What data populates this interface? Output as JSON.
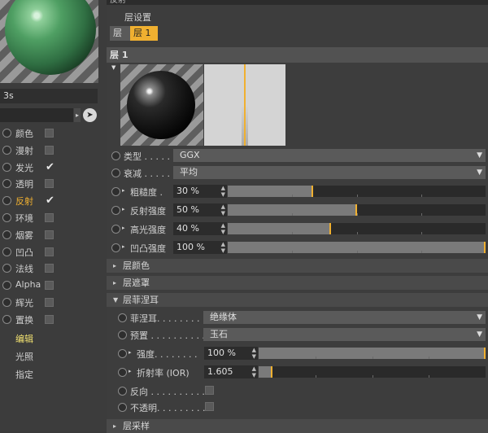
{
  "left": {
    "preset_name": "3s",
    "channels": [
      {
        "label": "颜色",
        "checked": false,
        "active": false
      },
      {
        "label": "漫射",
        "checked": false,
        "active": false
      },
      {
        "label": "发光",
        "checked": true,
        "active": false
      },
      {
        "label": "透明",
        "checked": false,
        "active": false
      },
      {
        "label": "反射",
        "checked": true,
        "active": true
      },
      {
        "label": "环境",
        "checked": false,
        "active": false
      },
      {
        "label": "烟雾",
        "checked": false,
        "active": false
      },
      {
        "label": "凹凸",
        "checked": false,
        "active": false
      },
      {
        "label": "法线",
        "checked": false,
        "active": false
      },
      {
        "label": "Alpha",
        "checked": false,
        "active": false
      },
      {
        "label": "辉光",
        "checked": false,
        "active": false
      },
      {
        "label": "置换",
        "checked": false,
        "active": false
      }
    ],
    "sub_items": [
      "编辑",
      "光照",
      "指定"
    ]
  },
  "right": {
    "top_title": "反射",
    "layer_settings_label": "层设置",
    "tab_layer": "层",
    "tab_layer1": "层 1",
    "section_layer1": "层 1",
    "type_label": "类型 . . . . . .",
    "type_value": "GGX",
    "attenuation_label": "衰减 . . . . . .",
    "attenuation_value": "平均",
    "roughness_label": "粗糙度 .",
    "roughness_value": "30 %",
    "roughness_level": 0.33,
    "reflect_strength_label": "反射强度",
    "reflect_strength_value": "50 %",
    "reflect_strength_level": 0.5,
    "specular_label": "高光强度",
    "specular_value": "40 %",
    "specular_level": 0.4,
    "bump_label": "凹凸强度",
    "bump_value": "100 %",
    "bump_level": 1.0,
    "section_layer_color": "层颜色",
    "section_layer_mask": "层遮罩",
    "section_fresnel": "层菲涅耳",
    "fresnel_label": "菲涅耳. . . . . . . . . .",
    "fresnel_value": "绝缘体",
    "preset_label": "预置 . . . . . . . . . . . .",
    "preset_value": "玉石",
    "strength_label": "强度. . . . . . . .",
    "strength_value": "100 %",
    "strength_level": 1.0,
    "ior_label": "折射率 (IOR)",
    "ior_value": "1.605",
    "ior_level": 0.06,
    "invert_label": "反向 . . . . . . . . . .",
    "opaque_label": "不透明. . . . . . . . .",
    "section_sampling": "层采样"
  }
}
